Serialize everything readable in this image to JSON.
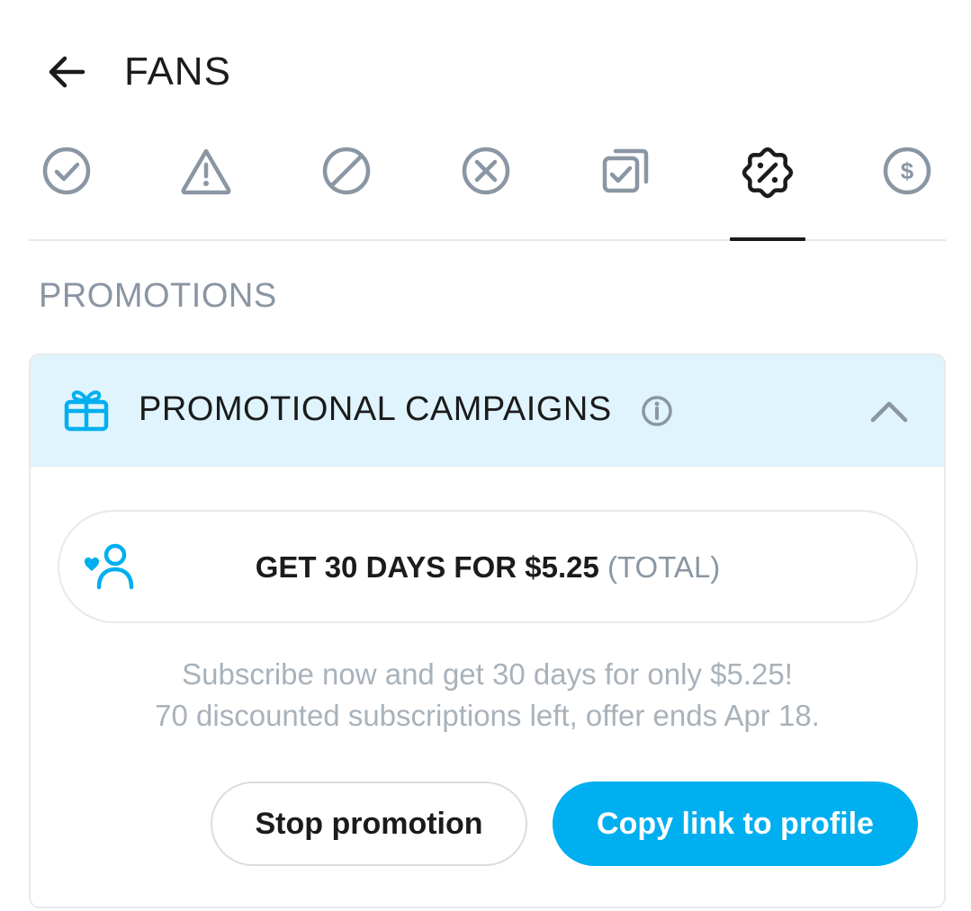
{
  "header": {
    "title": "FANS",
    "back_icon": "arrow-left-icon"
  },
  "tabs": [
    {
      "icon": "check-circle-icon",
      "active": false
    },
    {
      "icon": "warning-triangle-icon",
      "active": false
    },
    {
      "icon": "block-icon",
      "active": false
    },
    {
      "icon": "x-circle-icon",
      "active": false
    },
    {
      "icon": "stacked-check-icon",
      "active": false
    },
    {
      "icon": "discount-badge-icon",
      "active": true
    },
    {
      "icon": "dollar-circle-icon",
      "active": false
    }
  ],
  "section": {
    "title": "PROMOTIONS"
  },
  "card": {
    "icon": "gift-icon",
    "title": "PROMOTIONAL CAMPAIGNS",
    "info_icon": "info-icon",
    "collapse_icon": "chevron-up-icon",
    "offer": {
      "icon": "heart-user-icon",
      "main": "GET 30 DAYS FOR $5.25",
      "suffix": "(TOTAL)"
    },
    "description_line1": "Subscribe now and get 30 days for only $5.25!",
    "description_line2": "70 discounted subscriptions left, offer ends Apr 18.",
    "stop_label": "Stop promotion",
    "copy_label": "Copy link to profile"
  },
  "colors": {
    "accent": "#00aff0",
    "header_bg": "#e0f4fd",
    "muted_text": "#8a96a3",
    "icon_gray": "#8a96a3",
    "border": "#e6e9ec"
  }
}
